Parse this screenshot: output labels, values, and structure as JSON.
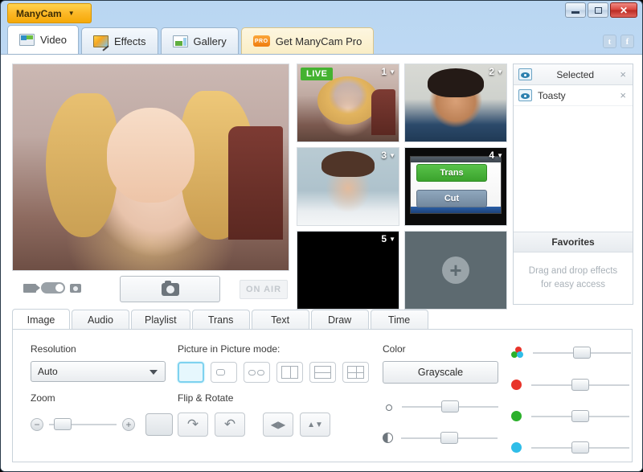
{
  "app": {
    "menu_label": "ManyCam",
    "menu_caret": "▼"
  },
  "window_controls": {
    "minimize": "minimize-button",
    "maximize": "maximize-button",
    "close": "✕"
  },
  "social": {
    "twitter": "t",
    "facebook": "f"
  },
  "tabs": [
    {
      "label": "Video",
      "icon": "video-icon",
      "active": true
    },
    {
      "label": "Effects",
      "icon": "effects-icon",
      "active": false
    },
    {
      "label": "Gallery",
      "icon": "gallery-icon",
      "active": false
    },
    {
      "label": "Get ManyCam Pro",
      "icon": "pro-badge-icon",
      "badge": "PRO",
      "active": false
    }
  ],
  "preview": {
    "toolbar": {
      "video_mode_icon": "video-camera-icon",
      "mode_switch": "video-photo-toggle",
      "photo_mode_icon": "photo-camera-icon",
      "shutter_label": "shutter-button",
      "on_air": "ON AIR"
    }
  },
  "thumbnails": [
    {
      "number": "1",
      "caret": "▼",
      "badge": "LIVE",
      "kind": "webcam-woman"
    },
    {
      "number": "2",
      "caret": "▼",
      "badge": "",
      "kind": "webcam-man"
    },
    {
      "number": "3",
      "caret": "▼",
      "badge": "",
      "kind": "webcam-woman-2"
    },
    {
      "number": "4",
      "caret": "▼",
      "badge": "",
      "kind": "desktop-capture",
      "overlay_buttons": [
        {
          "label": "Trans"
        },
        {
          "label": "Cut"
        }
      ]
    },
    {
      "number": "5",
      "caret": "▼",
      "badge": "",
      "kind": "empty-black"
    },
    {
      "number": "",
      "caret": "",
      "badge": "",
      "kind": "add-source",
      "plus": "+"
    }
  ],
  "right_panel": {
    "selected_header": "Selected",
    "close_glyph": "×",
    "items": [
      {
        "label": "Toasty",
        "close_glyph": "×"
      }
    ],
    "favorites_header": "Favorites",
    "favorites_hint_line1": "Drag and drop effects",
    "favorites_hint_line2": "for easy access"
  },
  "bottom_tabs": [
    {
      "label": "Image",
      "active": true
    },
    {
      "label": "Audio",
      "active": false
    },
    {
      "label": "Playlist",
      "active": false
    },
    {
      "label": "Trans",
      "active": false
    },
    {
      "label": "Text",
      "active": false
    },
    {
      "label": "Draw",
      "active": false
    },
    {
      "label": "Time",
      "active": false
    }
  ],
  "image_panel": {
    "resolution": {
      "label": "Resolution",
      "value": "Auto",
      "caret": "▼"
    },
    "zoom": {
      "label": "Zoom",
      "minus": "−",
      "plus": "+",
      "slider_percent": 12
    },
    "pip": {
      "label": "Picture in Picture mode:",
      "modes": [
        {
          "name": "full-screen",
          "selected": true
        },
        {
          "name": "small-inset",
          "selected": false
        },
        {
          "name": "two-inset",
          "selected": false
        },
        {
          "name": "vertical-split",
          "selected": false
        },
        {
          "name": "horizontal-split",
          "selected": false
        },
        {
          "name": "quad-split",
          "selected": false
        }
      ]
    },
    "flip_rotate": {
      "label": "Flip & Rotate",
      "buttons": [
        {
          "name": "rotate-right-button",
          "glyph": "↷"
        },
        {
          "name": "rotate-left-button",
          "glyph": "↶"
        },
        {
          "name": "flip-horizontal-button",
          "glyph": "◀▶"
        },
        {
          "name": "flip-vertical-button",
          "glyph": "▲▼"
        }
      ]
    },
    "color": {
      "label": "Color",
      "grayscale_label": "Grayscale",
      "brightness": {
        "icon": "brightness-icon",
        "percent": 50
      },
      "contrast": {
        "icon": "contrast-icon",
        "percent": 50
      }
    },
    "rgb_sliders": [
      {
        "name": "saturation-slider",
        "color": "#5cc4e8",
        "percent": 50
      },
      {
        "name": "red-slider",
        "color": "#e8342a",
        "percent": 50
      },
      {
        "name": "green-slider",
        "color": "#2bb02b",
        "percent": 50
      },
      {
        "name": "blue-slider",
        "color": "#2fbde8",
        "percent": 50
      }
    ]
  },
  "colors": {
    "accent_blue": "#b9d6f2",
    "manycam_yellow": "#fcb827",
    "live_green": "#44b230",
    "close_red": "#d9453c"
  }
}
